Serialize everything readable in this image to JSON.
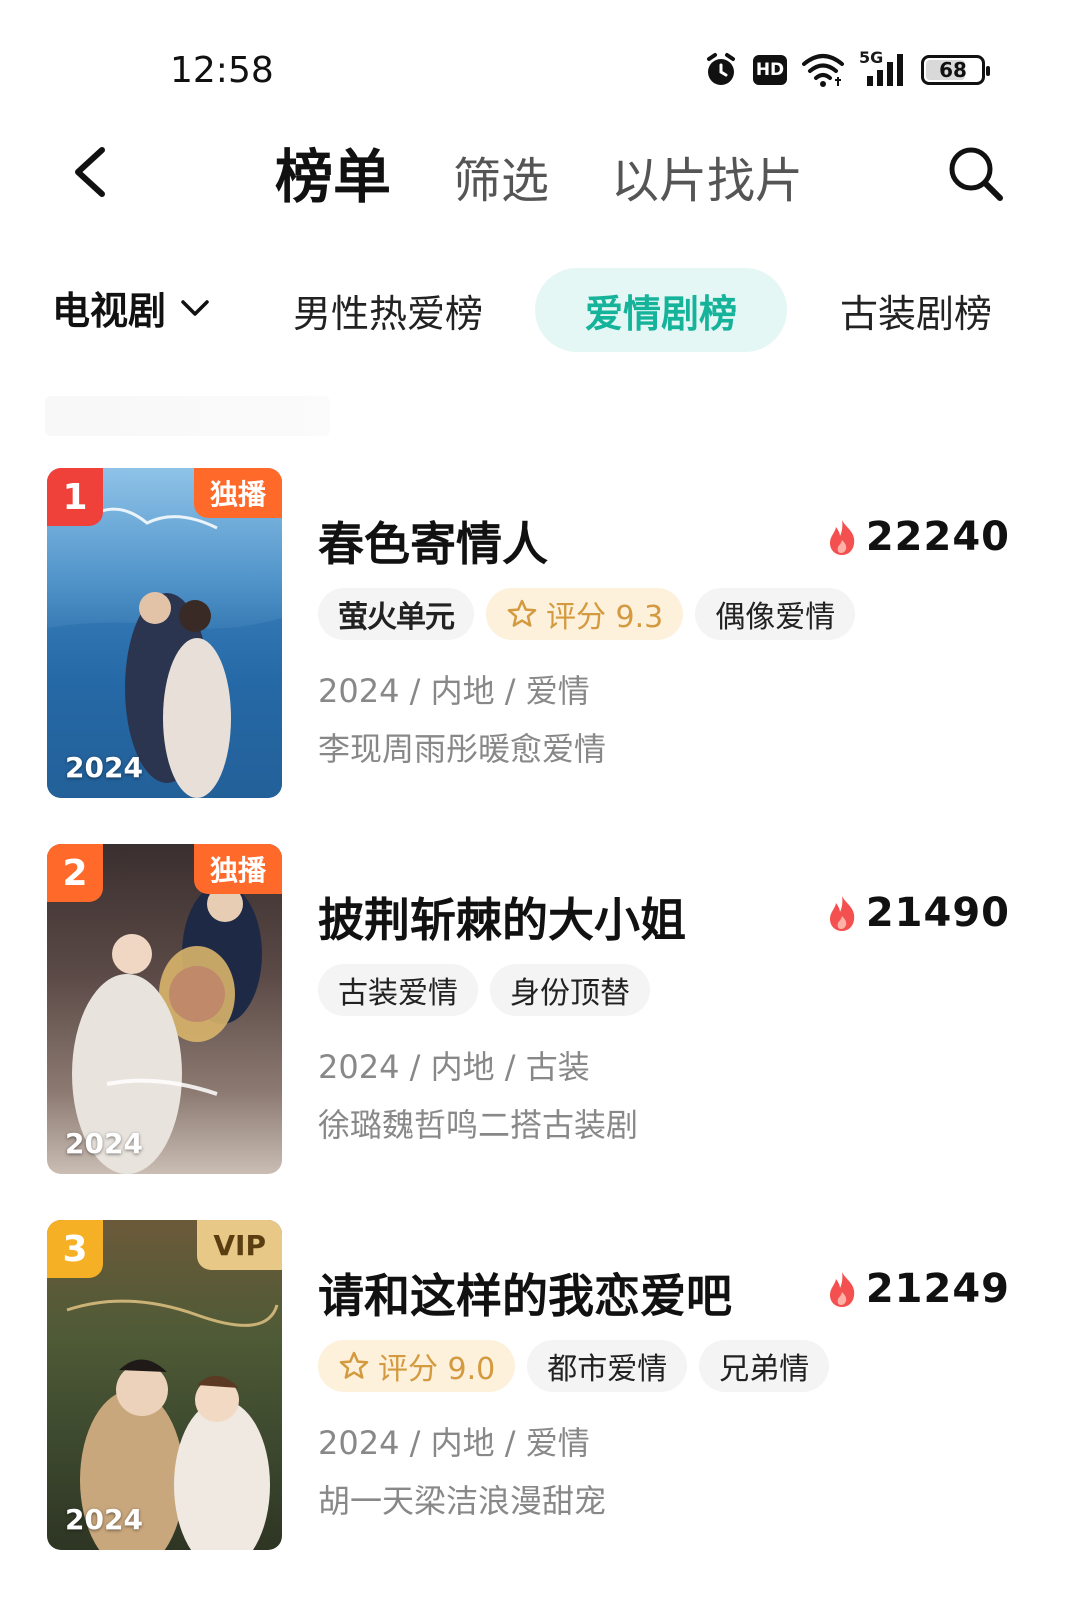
{
  "status_bar": {
    "time": "12:58",
    "hd_label": "HD",
    "network_label": "5G",
    "battery_level": "68",
    "icons": [
      "alarm-icon",
      "hd-icon",
      "wifi-icon",
      "signal-5g-icon",
      "battery-icon"
    ]
  },
  "header": {
    "tabs": [
      {
        "label": "榜单",
        "active": true
      },
      {
        "label": "筛选",
        "active": false
      },
      {
        "label": "以片找片",
        "active": false
      }
    ],
    "back_icon": "chevron-left-icon",
    "search_icon": "search-icon"
  },
  "category_bar": {
    "dropdown_label": "电视剧",
    "dropdown_icon": "chevron-down-icon",
    "pills": [
      {
        "label": "男性热爱榜",
        "active": false
      },
      {
        "label": "爱情剧榜",
        "active": true
      },
      {
        "label": "古装剧榜",
        "active": false
      }
    ],
    "accent_color": "#16b39b"
  },
  "items": [
    {
      "rank": "1",
      "rank_color": "#f0403a",
      "corner_badge": "独播",
      "corner_color": "#ff6a2b",
      "poster_year": "2024",
      "title": "春色寄情人",
      "heat": "22240",
      "tags": [
        {
          "label": "萤火单元",
          "type": "brand"
        },
        {
          "label": "评分 9.3",
          "type": "rating"
        },
        {
          "label": "偶像爱情",
          "type": "plain"
        }
      ],
      "meta": "2024 / 内地 / 爱情",
      "desc": "李现周雨彤暖愈爱情"
    },
    {
      "rank": "2",
      "rank_color": "#ff6a2b",
      "corner_badge": "独播",
      "corner_color": "#ff6a2b",
      "poster_year": "2024",
      "title": "披荆斩棘的大小姐",
      "heat": "21490",
      "tags": [
        {
          "label": "古装爱情",
          "type": "plain"
        },
        {
          "label": "身份顶替",
          "type": "plain"
        }
      ],
      "meta": "2024 / 内地 / 古装",
      "desc": "徐璐魏哲鸣二搭古装剧"
    },
    {
      "rank": "3",
      "rank_color": "#f5b025",
      "corner_badge": "VIP",
      "corner_color": "#e7c887",
      "poster_year": "2024",
      "title": "请和这样的我恋爱吧",
      "heat": "21249",
      "tags": [
        {
          "label": "评分 9.0",
          "type": "rating"
        },
        {
          "label": "都市爱情",
          "type": "plain"
        },
        {
          "label": "兄弟情",
          "type": "plain"
        }
      ],
      "meta": "2024 / 内地 / 爱情",
      "desc": "胡一天梁洁浪漫甜宠"
    }
  ]
}
